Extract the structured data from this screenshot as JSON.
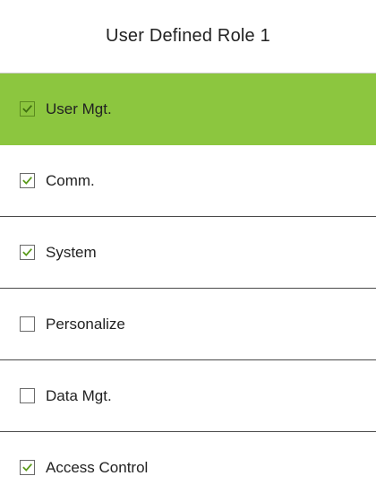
{
  "header": {
    "title": "User Defined Role 1"
  },
  "menu": {
    "items": [
      {
        "label": "User Mgt.",
        "checked": true,
        "selected": true
      },
      {
        "label": "Comm.",
        "checked": true,
        "selected": false
      },
      {
        "label": "System",
        "checked": true,
        "selected": false
      },
      {
        "label": "Personalize",
        "checked": false,
        "selected": false
      },
      {
        "label": "Data Mgt.",
        "checked": false,
        "selected": false
      },
      {
        "label": "Access Control",
        "checked": true,
        "selected": false
      }
    ]
  },
  "colors": {
    "highlight": "#8cc63f",
    "check": "#5a9a1a",
    "divider": "#4a4a4a"
  },
  "icons": {
    "checked": "checkbox-checked-icon",
    "unchecked": "checkbox-unchecked-icon"
  }
}
